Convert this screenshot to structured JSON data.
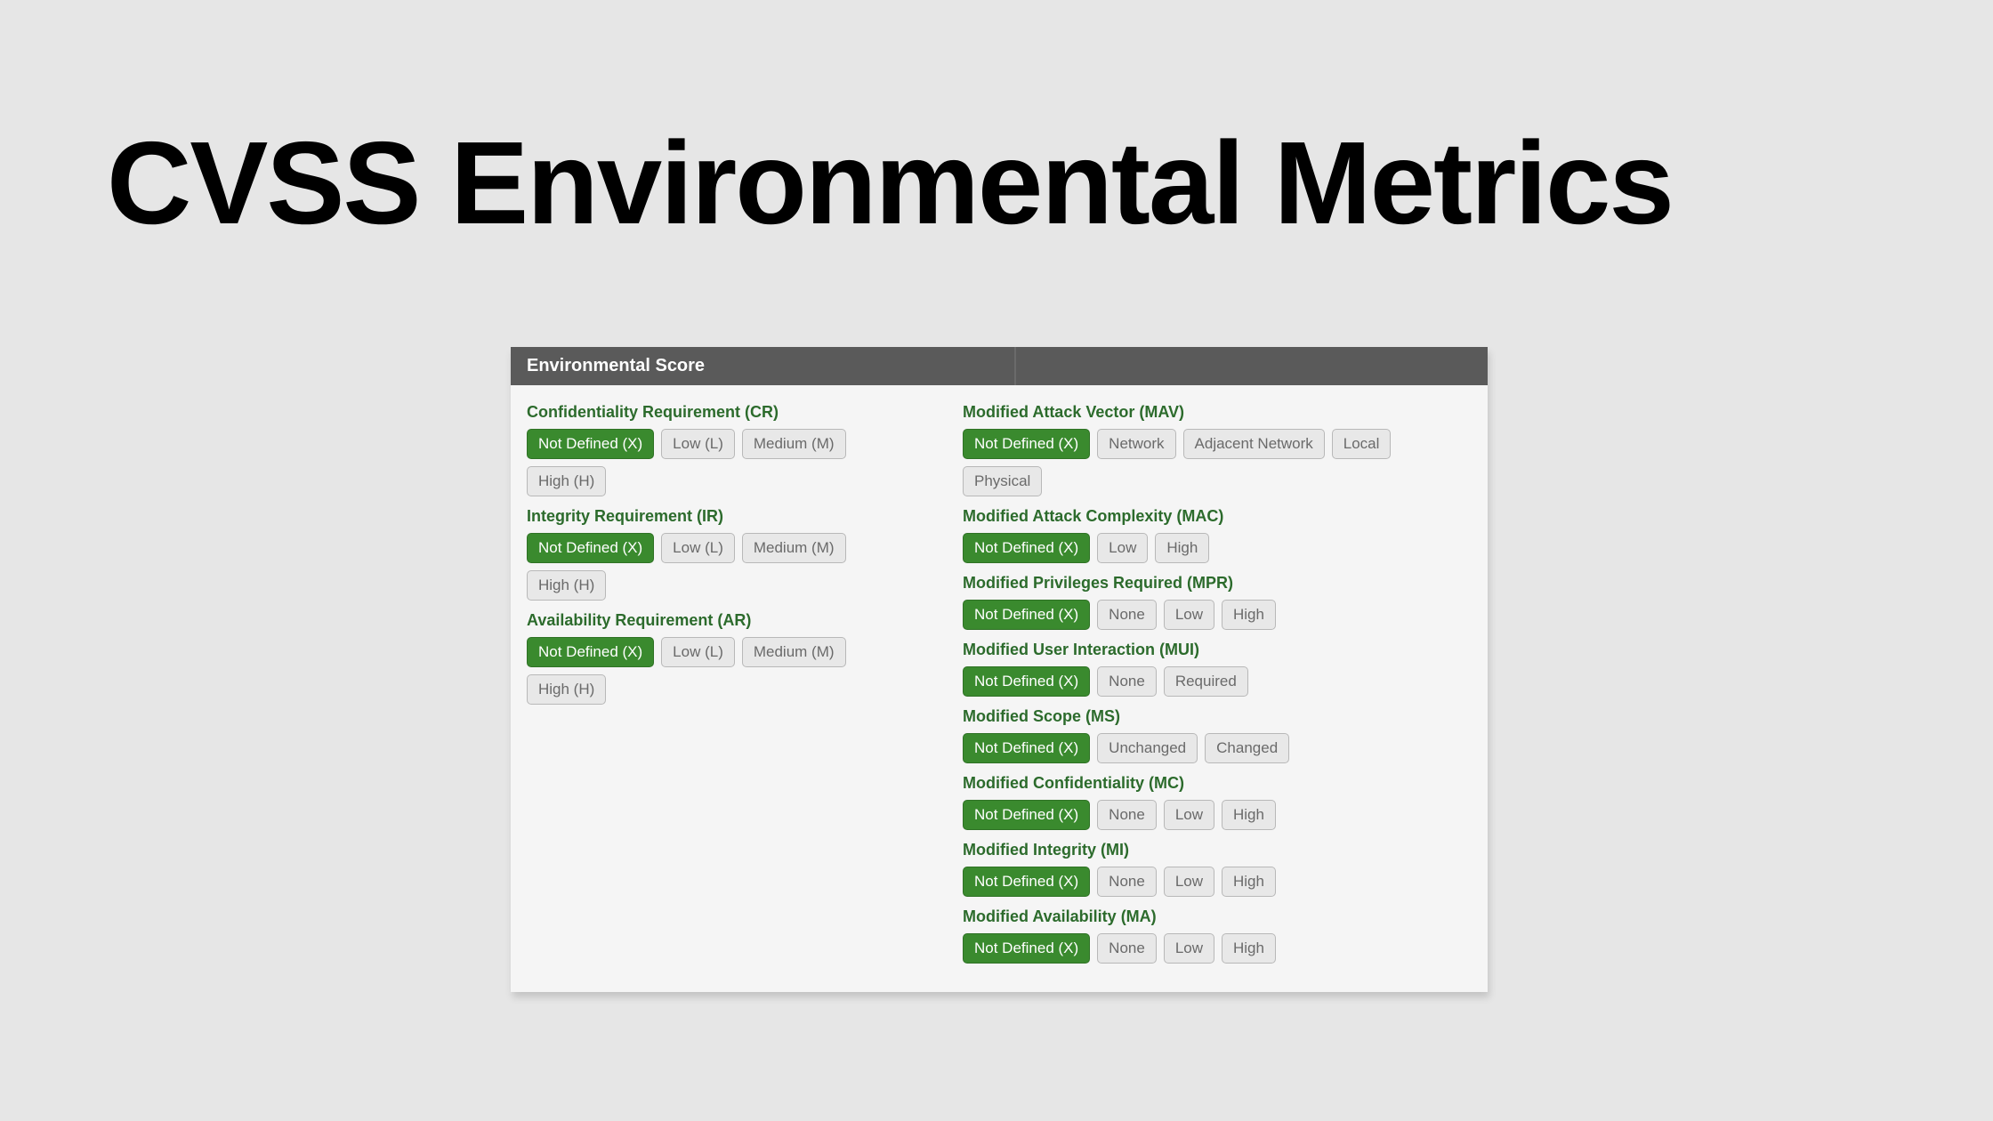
{
  "title": "CVSS  Environmental Metrics",
  "panel_header": "Environmental Score",
  "left": {
    "cr": {
      "label": "Confidentiality Requirement (CR)",
      "opts": [
        "Not Defined (X)",
        "Low (L)",
        "Medium (M)",
        "High (H)"
      ],
      "selected": 0
    },
    "ir": {
      "label": "Integrity Requirement (IR)",
      "opts": [
        "Not Defined (X)",
        "Low (L)",
        "Medium (M)",
        "High (H)"
      ],
      "selected": 0
    },
    "ar": {
      "label": "Availability Requirement (AR)",
      "opts": [
        "Not Defined (X)",
        "Low (L)",
        "Medium (M)",
        "High (H)"
      ],
      "selected": 0
    }
  },
  "right": {
    "mav": {
      "label": "Modified Attack Vector (MAV)",
      "opts": [
        "Not Defined (X)",
        "Network",
        "Adjacent Network",
        "Local",
        "Physical"
      ],
      "selected": 0
    },
    "mac": {
      "label": "Modified Attack Complexity (MAC)",
      "opts": [
        "Not Defined (X)",
        "Low",
        "High"
      ],
      "selected": 0
    },
    "mpr": {
      "label": "Modified Privileges Required (MPR)",
      "opts": [
        "Not Defined (X)",
        "None",
        "Low",
        "High"
      ],
      "selected": 0
    },
    "mui": {
      "label": "Modified User Interaction (MUI)",
      "opts": [
        "Not Defined (X)",
        "None",
        "Required"
      ],
      "selected": 0
    },
    "ms": {
      "label": "Modified Scope (MS)",
      "opts": [
        "Not Defined (X)",
        "Unchanged",
        "Changed"
      ],
      "selected": 0
    },
    "mc": {
      "label": "Modified Confidentiality (MC)",
      "opts": [
        "Not Defined (X)",
        "None",
        "Low",
        "High"
      ],
      "selected": 0
    },
    "mi": {
      "label": "Modified Integrity (MI)",
      "opts": [
        "Not Defined (X)",
        "None",
        "Low",
        "High"
      ],
      "selected": 0
    },
    "ma": {
      "label": "Modified Availability (MA)",
      "opts": [
        "Not Defined (X)",
        "None",
        "Low",
        "High"
      ],
      "selected": 0
    }
  }
}
